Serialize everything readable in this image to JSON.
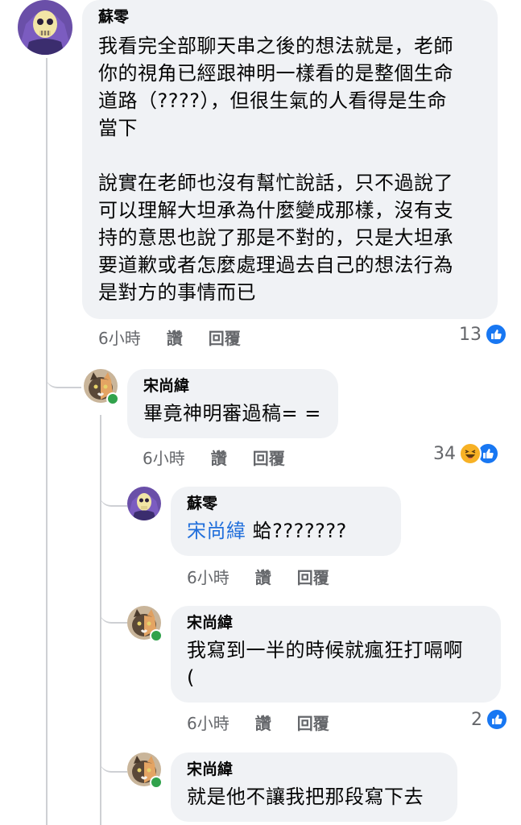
{
  "comments": [
    {
      "author": "蘇零",
      "text": "我看完全部聊天串之後的想法就是，老師\n你的視角已經跟神明一樣看的是整個生命\n道路（????），但很生氣的人看得是生命\n當下\n\n說實在老師也沒有幫忙說話，只不過說了\n可以理解大坦承為什麼變成那樣，沒有支\n持的意思也說了那是不對的，只是大坦承\n要道歉或者怎麼處理過去自己的想法行為\n是對方的事情而已",
      "time": "6小時",
      "like_label": "讚",
      "reply_label": "回覆",
      "reaction_count": "13",
      "reactions": [
        "like-icon"
      ]
    },
    {
      "author": "宋尚緯",
      "text": "畢竟神明審過稿= =",
      "time": "6小時",
      "like_label": "讚",
      "reply_label": "回覆",
      "reaction_count": "34",
      "reactions": [
        "haha-icon",
        "like-icon"
      ]
    },
    {
      "author": "蘇零",
      "mention": "宋尚緯",
      "text": " 蛤???????",
      "time": "6小時",
      "like_label": "讚",
      "reply_label": "回覆"
    },
    {
      "author": "宋尚緯",
      "text": "我寫到一半的時候就瘋狂打嗝啊\n(",
      "time": "6小時",
      "like_label": "讚",
      "reply_label": "回覆",
      "reaction_count": "2",
      "reactions": [
        "like-icon"
      ]
    },
    {
      "author": "宋尚緯",
      "text": "就是他不讓我把那段寫下去"
    }
  ],
  "colors": {
    "bubble": "#f0f2f5",
    "thread_line": "#ced0d4",
    "like": "#1877f2",
    "online": "#31a24c",
    "mention": "#216fdb"
  }
}
